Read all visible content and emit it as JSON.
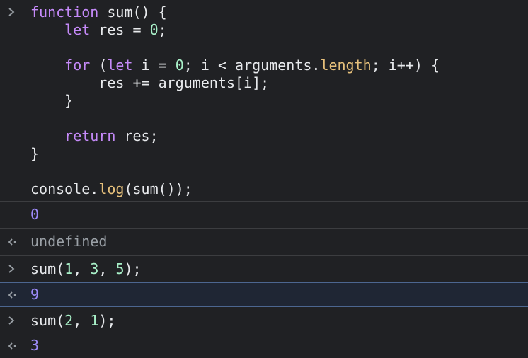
{
  "input_block": {
    "lines": [
      [
        {
          "t": "kw",
          "v": "function"
        },
        {
          "t": "p",
          "v": " sum() {"
        }
      ],
      [
        {
          "t": "p",
          "v": "    "
        },
        {
          "t": "kw",
          "v": "let"
        },
        {
          "t": "p",
          "v": " res = "
        },
        {
          "t": "num",
          "v": "0"
        },
        {
          "t": "p",
          "v": ";"
        }
      ],
      [
        {
          "t": "p",
          "v": ""
        }
      ],
      [
        {
          "t": "p",
          "v": "    "
        },
        {
          "t": "kw",
          "v": "for"
        },
        {
          "t": "p",
          "v": " ("
        },
        {
          "t": "kw",
          "v": "let"
        },
        {
          "t": "p",
          "v": " i = "
        },
        {
          "t": "num",
          "v": "0"
        },
        {
          "t": "p",
          "v": "; i < arguments."
        },
        {
          "t": "prop",
          "v": "length"
        },
        {
          "t": "p",
          "v": "; i++) {"
        }
      ],
      [
        {
          "t": "p",
          "v": "        res += arguments[i];"
        }
      ],
      [
        {
          "t": "p",
          "v": "    }"
        }
      ],
      [
        {
          "t": "p",
          "v": ""
        }
      ],
      [
        {
          "t": "p",
          "v": "    "
        },
        {
          "t": "kw",
          "v": "return"
        },
        {
          "t": "p",
          "v": " res;"
        }
      ],
      [
        {
          "t": "p",
          "v": "}"
        }
      ],
      [
        {
          "t": "p",
          "v": ""
        }
      ],
      [
        {
          "t": "p",
          "v": "console."
        },
        {
          "t": "prop",
          "v": "log"
        },
        {
          "t": "p",
          "v": "(sum());"
        }
      ]
    ]
  },
  "log_output": "0",
  "return_undefined": "undefined",
  "input_2": [
    {
      "t": "p",
      "v": "sum("
    },
    {
      "t": "num",
      "v": "1"
    },
    {
      "t": "p",
      "v": ", "
    },
    {
      "t": "num",
      "v": "3"
    },
    {
      "t": "p",
      "v": ", "
    },
    {
      "t": "num",
      "v": "5"
    },
    {
      "t": "p",
      "v": ");"
    }
  ],
  "result_2": "9",
  "input_3": [
    {
      "t": "p",
      "v": "sum("
    },
    {
      "t": "num",
      "v": "2"
    },
    {
      "t": "p",
      "v": ", "
    },
    {
      "t": "num",
      "v": "1"
    },
    {
      "t": "p",
      "v": ");"
    }
  ],
  "result_3": "3",
  "icons": {
    "input_prompt": "chevron-right-icon",
    "return_marker": "return-arrow-icon"
  },
  "colors": {
    "background": "#202124",
    "keyword": "#c58af9",
    "number": "#a8f0c8",
    "property": "#e6c07b",
    "result_number": "#9d8bf9",
    "muted": "#9aa0a6",
    "highlight_border": "#4c6690"
  }
}
